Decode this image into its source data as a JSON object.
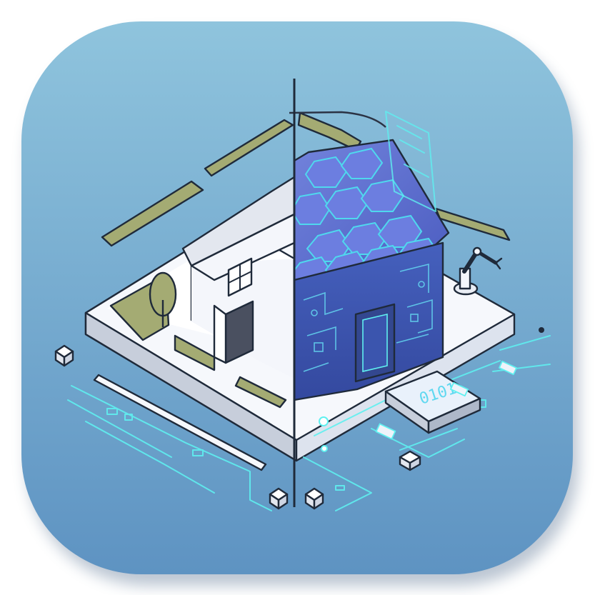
{
  "app_icon": {
    "colors": {
      "background_top": "#8fc4dd",
      "background_bottom": "#5e93c2",
      "house_wall": "#f4f6fb",
      "house_shadow": "#c9d0dc",
      "roof_tiles": "#5c6fd0",
      "circuit_wall": "#3f58b4",
      "accent_cyan": "#5ff0f0",
      "grass": "#a4ab73"
    },
    "icons": [
      "house-icon",
      "tree-icon",
      "hex-solar-roof-icon",
      "circuit-wall-icon",
      "robot-arm-icon",
      "divider-line-icon",
      "cube-icon"
    ],
    "panel_text": "0101"
  }
}
